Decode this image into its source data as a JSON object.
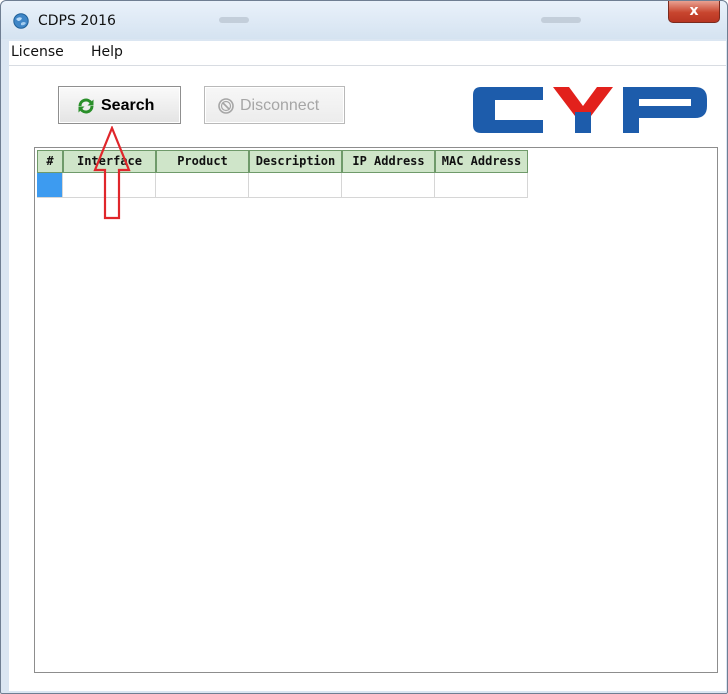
{
  "window": {
    "title": "CDPS 2016",
    "close_label": "x"
  },
  "menu": {
    "items": [
      "License",
      "Help"
    ]
  },
  "toolbar": {
    "search_label": "Search",
    "disconnect_label": "Disconnect",
    "search_icon": "refresh-icon",
    "disconnect_icon": "ban-icon"
  },
  "logo": {
    "text": "CYP",
    "colors": {
      "blue": "#1d5cab",
      "red": "#e2211c"
    }
  },
  "table": {
    "columns": [
      "#",
      "Interface",
      "Product",
      "Description",
      "IP Address",
      "MAC Address"
    ],
    "rows": [
      [
        "",
        "",
        "",
        "",
        "",
        ""
      ]
    ],
    "header_color": "#cfe5c9",
    "selected_row_color": "#3d9bf0"
  },
  "annotation": {
    "arrow_color": "#e0262b",
    "points_to": "search-button"
  }
}
